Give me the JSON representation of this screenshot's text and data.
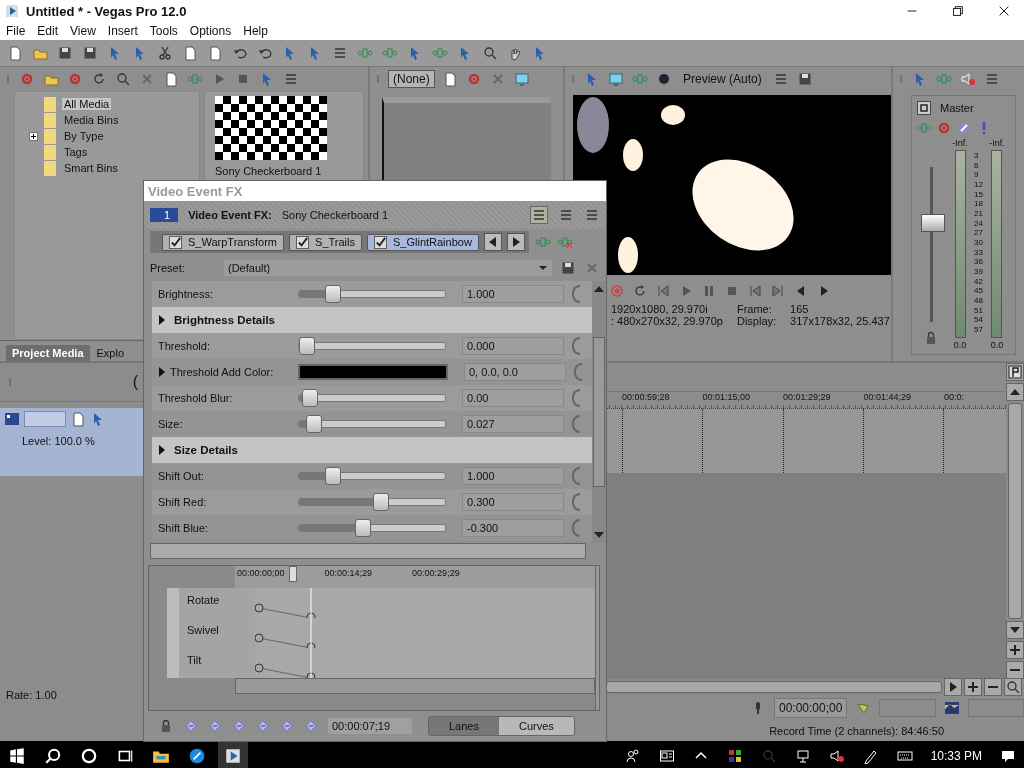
{
  "window": {
    "title": "Untitled * - Vegas Pro 12.0"
  },
  "menu": [
    "File",
    "Edit",
    "View",
    "Insert",
    "Tools",
    "Options",
    "Help"
  ],
  "media_tree": [
    {
      "label": "All Media",
      "selected": true,
      "expandable": false
    },
    {
      "label": "Media Bins",
      "selected": false,
      "expandable": false
    },
    {
      "label": "By Type",
      "selected": false,
      "expandable": true
    },
    {
      "label": "Tags",
      "selected": false,
      "expandable": false
    },
    {
      "label": "Smart Bins",
      "selected": false,
      "expandable": false
    }
  ],
  "media_item": {
    "caption": "Sony Checkerboard 1"
  },
  "media_tabs": [
    {
      "label": "Project Media",
      "selected": true
    },
    {
      "label": "Explo",
      "selected": false
    }
  ],
  "trimmer": {
    "dropdown": "(None)"
  },
  "preview": {
    "quality": "Preview (Auto)",
    "info": [
      {
        "project": "1920x1080, 29.970i",
        "key": "Frame:",
        "value": "165"
      },
      {
        "project": ": 480x270x32, 29.970p",
        "key": "Display:",
        "value": "317x178x32, 25.437"
      }
    ]
  },
  "master": {
    "label": "Master",
    "peaks": [
      "-Inf.",
      "-Inf."
    ],
    "scale": [
      "3",
      "6",
      "9",
      "12",
      "15",
      "18",
      "21",
      "24",
      "27",
      "30",
      "33",
      "36",
      "39",
      "42",
      "45",
      "48",
      "51",
      "54",
      "57"
    ],
    "readouts": [
      "0.0",
      "0.0"
    ],
    "fader": {
      "level": 0.64
    }
  },
  "track": {
    "fragment": "(",
    "level_label": "Level: 100.0 %",
    "rate": "Rate: 1.00"
  },
  "timeline": {
    "ruler": [
      "00:00:59;28",
      "00:01:15;00",
      "00:01:29;29",
      "00:01:44;29",
      "00:0:"
    ],
    "cursor_time": "00:00:00;00",
    "status": "Record Time (2 channels): 84:46:50"
  },
  "fx": {
    "title": "Video Event FX",
    "track_number": "1",
    "header_label": "Video Event FX:",
    "media": "Sony Checkerboard 1",
    "chain": [
      {
        "name": "S_WarpTransform",
        "enabled": true,
        "selected": false
      },
      {
        "name": "S_Trails",
        "enabled": true,
        "selected": false
      },
      {
        "name": "S_GlintRainbow",
        "enabled": true,
        "selected": true
      }
    ],
    "preset_label": "Preset:",
    "preset": "(Default)",
    "params": [
      {
        "kind": "slider",
        "label": "Brightness:",
        "level": 0.2,
        "value": "1.000"
      },
      {
        "kind": "section",
        "label": "Brightness Details"
      },
      {
        "kind": "slider",
        "label": "Threshold:",
        "level": 0.0,
        "value": "0.000"
      },
      {
        "kind": "color",
        "label": "Threshold Add Color:",
        "color": "#000000",
        "value": "0, 0.0, 0.0"
      },
      {
        "kind": "slider",
        "label": "Threshold Blur:",
        "level": 0.02,
        "value": "0.00"
      },
      {
        "kind": "slider",
        "label": "Size:",
        "level": 0.05,
        "value": "0.027"
      },
      {
        "kind": "section",
        "label": "Size Details"
      },
      {
        "kind": "slider",
        "label": "Shift Out:",
        "level": 0.2,
        "value": "1.000"
      },
      {
        "kind": "slider",
        "label": "Shift Red:",
        "level": 0.57,
        "value": "0.300"
      },
      {
        "kind": "slider",
        "label": "Shift Blue:",
        "level": 0.43,
        "value": "-0.300"
      }
    ],
    "keyframes": {
      "ruler": [
        "00:00:00;00",
        "00:00:14;29",
        "00:00:29;29"
      ],
      "lanes": [
        "Rotate",
        "Swivel",
        "Tilt"
      ],
      "time": "00:00:07;19",
      "modes": [
        {
          "label": "Lanes",
          "selected": true
        },
        {
          "label": "Curves",
          "selected": false
        }
      ]
    }
  },
  "taskbar": {
    "clock": "10:33 PM"
  }
}
